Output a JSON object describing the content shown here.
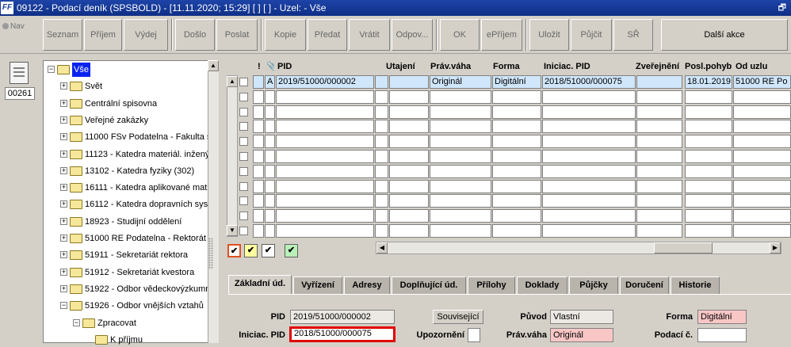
{
  "title_bar": {
    "logo": "FF",
    "title": "09122 - Podací deník (SPSBOLD) - [11.11.2020; 15:29]  [ ]  [ ] - Uzel: - Vše",
    "restore": "🗗"
  },
  "toolbar": {
    "nav": "Nav",
    "buttons": [
      "Seznam",
      "Příjem",
      "Výdej",
      "Došlo",
      "Poslat",
      "Kopie",
      "Předat",
      "Vrátit",
      "Odpov...",
      "OK",
      "ePříjem",
      "Uložit",
      "Půjčit",
      "SŘ"
    ],
    "more": "Další akce"
  },
  "left": {
    "record_count": "00261"
  },
  "tree": [
    {
      "label": "Vše",
      "level": 0,
      "expander": "−",
      "selected": true
    },
    {
      "label": "Svět",
      "level": 1,
      "expander": "+"
    },
    {
      "label": "Centrální spisovna",
      "level": 1,
      "expander": "+"
    },
    {
      "label": "Veřejné zakázky",
      "level": 1,
      "expander": "+"
    },
    {
      "label": "11000 FSv Podatelna - Fakulta s",
      "level": 1,
      "expander": "+"
    },
    {
      "label": "11123 - Katedra materiál. inženýr",
      "level": 1,
      "expander": "+"
    },
    {
      "label": "13102 - Katedra  fyziky (302)",
      "level": 1,
      "expander": "+"
    },
    {
      "label": "16111 - Katedra aplikované mat",
      "level": 1,
      "expander": "+"
    },
    {
      "label": "16112 - Katedra dopravních sys",
      "level": 1,
      "expander": "+"
    },
    {
      "label": "18923 - Studijní oddělení",
      "level": 1,
      "expander": "+"
    },
    {
      "label": "51000 RE Podatelna - Rektorát",
      "level": 1,
      "expander": "+"
    },
    {
      "label": "51911 - Sekretariát rektora",
      "level": 1,
      "expander": "+"
    },
    {
      "label": "51912 - Sekretariát kvestora",
      "level": 1,
      "expander": "+"
    },
    {
      "label": "51922 - Odbor vědeckovýzkumn",
      "level": 1,
      "expander": "+"
    },
    {
      "label": "51926 - Odbor vnějších vztahů",
      "level": 1,
      "expander": "−"
    },
    {
      "label": "Zpracovat",
      "level": 2,
      "expander": "−"
    },
    {
      "label": "K příjmu",
      "level": 3,
      "expander": ""
    }
  ],
  "grid": {
    "headers": {
      "excl": "!",
      "clip": "📎",
      "pid": "PID",
      "utajeni": "Utajení",
      "pravaha": "Práv.váha",
      "forma": "Forma",
      "iniciac": "Iniciac. PID",
      "zverejneni": "Zveřejnění",
      "poslpohyb": "Posl.pohyb",
      "oduzlu": "Od uzlu"
    },
    "row": {
      "flag": "A",
      "pid": "2019/51000/000002",
      "utajeni": "",
      "pravaha": "Originál",
      "forma": "Digitální",
      "iniciac": "2018/51000/000075",
      "zverejneni": "",
      "poslpohyb": "18.01.2019",
      "oduzlu": "51000 RE Po"
    },
    "empty_rows": 10
  },
  "filters": [
    "✔",
    "✔",
    "✔",
    "✔"
  ],
  "tabs": [
    "Základní úd.",
    "Vyřízení",
    "Adresy",
    "Doplňující úd.",
    "Přílohy",
    "Doklady",
    "Půjčky",
    "Doručení",
    "Historie"
  ],
  "detail": {
    "pid_label": "PID",
    "pid": "2019/51000/000002",
    "souvisejici": "Související",
    "puvod_label": "Původ",
    "puvod": "Vlastní",
    "forma_label": "Forma",
    "forma": "Digitální",
    "iniciac_label": "Iniciac. PID",
    "iniciac": "2018/51000/000075",
    "upozorneni_label": "Upozornění",
    "pravaha_label": "Práv.váha",
    "pravaha": "Originál",
    "podaci_label": "Podací č.",
    "podaci": ""
  },
  "colors": {
    "title_bar": "#0f2f86",
    "selection": "#0a24f0",
    "highlight_row": "#cfe6fb",
    "pink_field": "#f9c6c6",
    "focus_border": "#e00000"
  }
}
